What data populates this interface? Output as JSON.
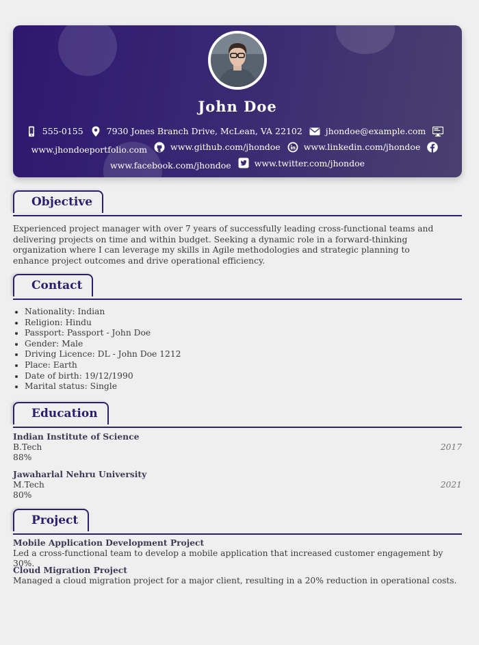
{
  "header": {
    "name": "John Doe",
    "contacts_line1": [
      {
        "icon": "phone-icon",
        "text": "555-0155"
      },
      {
        "icon": "location-pin-icon",
        "text": "7930 Jones Branch Drive, McLean, VA 22102"
      },
      {
        "icon": "envelope-icon",
        "text": "jhondoe@example.com"
      },
      {
        "icon": "monitor-icon",
        "text": ""
      }
    ],
    "contacts_line2": [
      {
        "icon": "",
        "text": "www.jhondoeportfolio.com"
      },
      {
        "icon": "github-icon",
        "text": "www.github.com/jhondoe"
      },
      {
        "icon": "linkedin-icon",
        "text": "www.linkedin.com/jhondoe"
      },
      {
        "icon": "facebook-icon",
        "text": ""
      }
    ],
    "contacts_line3": [
      {
        "icon": "",
        "text": "www.facebook.com/jhondoe"
      },
      {
        "icon": "twitter-icon",
        "text": "www.twitter.com/jhondoe"
      }
    ],
    "colors": {
      "gradient_start": "#2d1870",
      "gradient_end": "#4a4070",
      "accent": "#2b1f6b"
    }
  },
  "objective": {
    "title": "Objective",
    "text": "Experienced project manager with over 7 years of successfully leading cross-functional teams and delivering projects on time and within budget. Seeking a dynamic role in a forward-thinking organization where I can leverage my skills in Agile methodologies and strategic planning to enhance project outcomes and drive operational efficiency."
  },
  "contact": {
    "title": "Contact",
    "items": [
      "Nationality: Indian",
      "Religion: Hindu",
      "Passport: Passport - John Doe",
      "Gender: Male",
      "Driving Licence: DL - John Doe 1212",
      "Place: Earth",
      "Date of birth: 19/12/1990",
      "Marital status: Single"
    ]
  },
  "education": {
    "title": "Education",
    "items": [
      {
        "school": "Indian Institute of Science",
        "degree": "B.Tech",
        "score": "88%",
        "year": "2017"
      },
      {
        "school": "Jawaharlal Nehru University",
        "degree": "M.Tech",
        "score": "80%",
        "year": "2021"
      }
    ]
  },
  "project": {
    "title": "Project",
    "items": [
      {
        "name": "Mobile Application Development Project",
        "desc": "Led a cross-functional team to develop a mobile application that increased customer engagement by 30%."
      },
      {
        "name": "Cloud Migration Project",
        "desc": "Managed a cloud migration project for a major client, resulting in a 20% reduction in operational costs."
      }
    ]
  }
}
